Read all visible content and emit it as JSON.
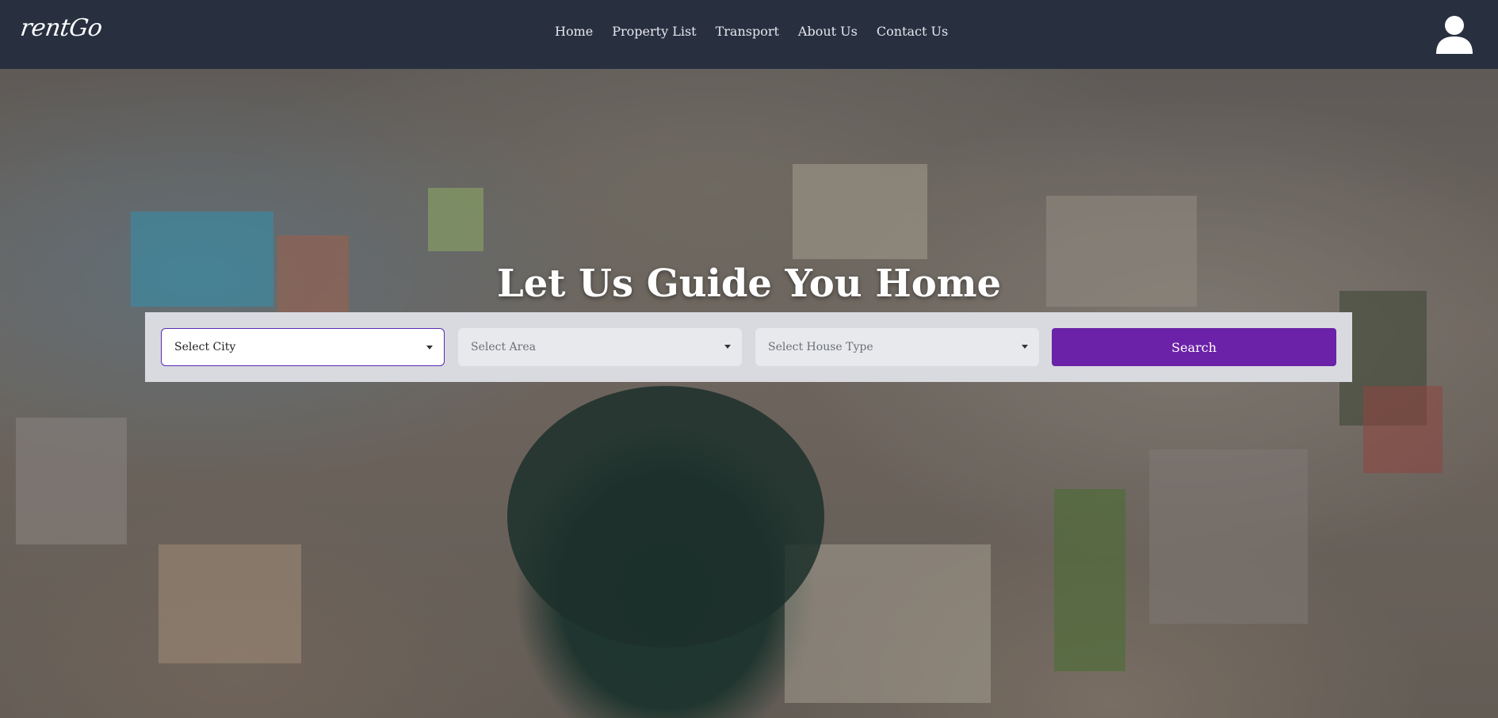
{
  "brand": {
    "logo_text": "rentGo"
  },
  "nav": {
    "items": [
      {
        "label": "Home"
      },
      {
        "label": "Property List"
      },
      {
        "label": "Transport"
      },
      {
        "label": "About Us"
      },
      {
        "label": "Contact Us"
      }
    ]
  },
  "user": {
    "icon": "user-avatar-icon"
  },
  "hero": {
    "title": "Let Us Guide You Home"
  },
  "search": {
    "city_placeholder": "Select City",
    "area_placeholder": "Select Area",
    "house_type_placeholder": "Select House Type",
    "button_label": "Search"
  },
  "colors": {
    "navbar_bg": "#283040",
    "accent": "#6b21a8",
    "panel_bg": "#d8dae0"
  }
}
